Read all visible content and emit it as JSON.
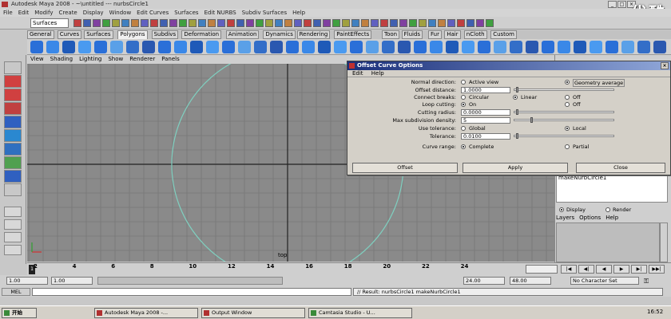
{
  "window": {
    "title": "Autodesk Maya 2008 - ~\\untitled  ---  nurbsCircle1"
  },
  "watermark": "优酷",
  "menubar": [
    "File",
    "Edit",
    "Modify",
    "Create",
    "Display",
    "Window",
    "Edit Curves",
    "Surfaces",
    "Edit NURBS",
    "Subdiv Surfaces",
    "Help"
  ],
  "status": {
    "mode": "Surfaces"
  },
  "shelf_tabs": [
    "General",
    "Curves",
    "Surfaces",
    "Polygons",
    "Subdivs",
    "Deformation",
    "Animation",
    "Dynamics",
    "Rendering",
    "PaintEffects",
    "Toon",
    "Fluids",
    "Fur",
    "Hair",
    "nCloth",
    "Custom"
  ],
  "shelf_active": "Polygons",
  "panel_menu": [
    "View",
    "Shading",
    "Lighting",
    "Show",
    "Renderer",
    "Panels"
  ],
  "viewport": {
    "label": "top"
  },
  "dialog": {
    "title": "Offset Curve Options",
    "menu": [
      "Edit",
      "Help"
    ],
    "rows": {
      "normal_direction": {
        "label": "Normal direction:",
        "opt1": "Active view",
        "opt2": "Geometry average"
      },
      "offset_distance": {
        "label": "Offset distance:",
        "value": "1.0000"
      },
      "connect_breaks": {
        "label": "Connect breaks:",
        "opt1": "Circular",
        "opt2": "Linear",
        "opt3": "Off"
      },
      "loop_cutting": {
        "label": "Loop cutting:",
        "opt1": "On",
        "opt2": "Off"
      },
      "cutting_radius": {
        "label": "Cutting radius:",
        "value": "0.0000"
      },
      "max_subdiv": {
        "label": "Max subdivision density:",
        "value": "5"
      },
      "use_tolerance": {
        "label": "Use tolerance:",
        "opt1": "Global",
        "opt2": "Local"
      },
      "tolerance": {
        "label": "Tolerance:",
        "value": "0.0100"
      },
      "curve_range": {
        "label": "Curve range:",
        "opt1": "Complete",
        "opt2": "Partial"
      }
    },
    "buttons": {
      "offset": "Offset",
      "apply": "Apply",
      "close": "Close"
    }
  },
  "right_panel": {
    "channel_text": "makeNurbCircle1",
    "layer_display": "Display",
    "layer_render": "Render",
    "layer_menu": [
      "Layers",
      "Options",
      "Help"
    ]
  },
  "timeline": {
    "ticks": [
      "2",
      "4",
      "6",
      "8",
      "10",
      "12",
      "14",
      "16",
      "18",
      "20",
      "22",
      "24"
    ],
    "current_frame": "1"
  },
  "range": {
    "start": "1.00",
    "playback_start": "1.00",
    "playback_end": "24.00",
    "end": "48.00",
    "char_set": "No Character Set"
  },
  "mel": {
    "label": "MEL",
    "result": "// Result: nurbsCircle1 makeNurbCircle1"
  },
  "taskbar": {
    "start": "开始",
    "items": [
      "Autodesk Maya 2008 -...",
      "Output Window",
      "Camtasia Studio - U..."
    ],
    "clock": "16:52"
  }
}
